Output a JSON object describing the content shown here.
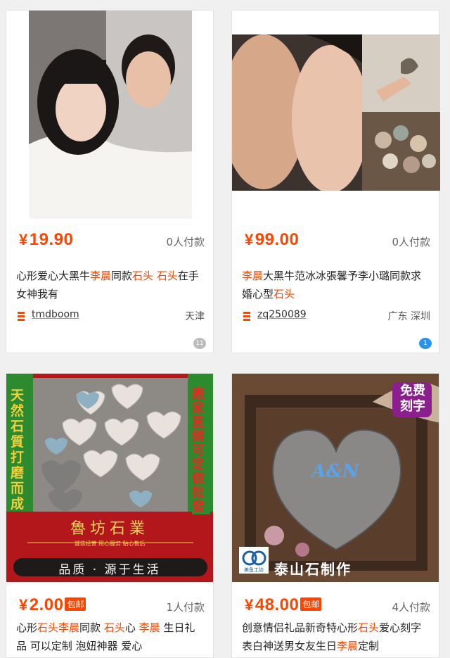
{
  "products": [
    {
      "price": "19.90",
      "currency": "¥",
      "paid": "0人付款",
      "title_parts": [
        "心形爱心大黑牛",
        "李晨",
        "同款",
        "石头",
        " ",
        "石头",
        "在手 女神我有"
      ],
      "shop": "tmdboom",
      "location": "天津",
      "bubble_count": "11"
    },
    {
      "price": "99.00",
      "currency": "¥",
      "paid": "0人付款",
      "title_parts": [
        "李晨",
        "大黑牛范冰冰張馨予李小璐同款求婚心型",
        "石头"
      ],
      "shop": "zq250089",
      "location": "广东 深圳",
      "bubble_count": "1"
    },
    {
      "price": "2.00",
      "currency": "¥",
      "badge": "包邮",
      "paid": "1人付款",
      "title_parts": [
        "心形",
        "石头",
        "李晨",
        "同款 ",
        "石头",
        "心 ",
        "李晨",
        " 生日礼品 可以定制 泡妞神器 爱心"
      ],
      "image_text": {
        "left_vertical": "天然石質打磨而成",
        "right_vertical": "廠家直銷 可定做批發",
        "brand": "魯坊石業",
        "sub": "诚信经营 用心服务 贴心售后",
        "slogan": "品质 · 源于生活"
      }
    },
    {
      "price": "48.00",
      "currency": "¥",
      "badge": "包邮",
      "paid": "4人付款",
      "title_parts": [
        "创意情侣礼品新奇特心形",
        "石头",
        "爱心刻字表白神送男女友生日",
        "李晨",
        "定制"
      ],
      "image_text": {
        "corner": "免费刻字",
        "engrave": "A&N",
        "logo_label": "美鱼工坊",
        "caption": "泰山石制作"
      }
    }
  ],
  "colors": {
    "accent": "#ff4400"
  }
}
